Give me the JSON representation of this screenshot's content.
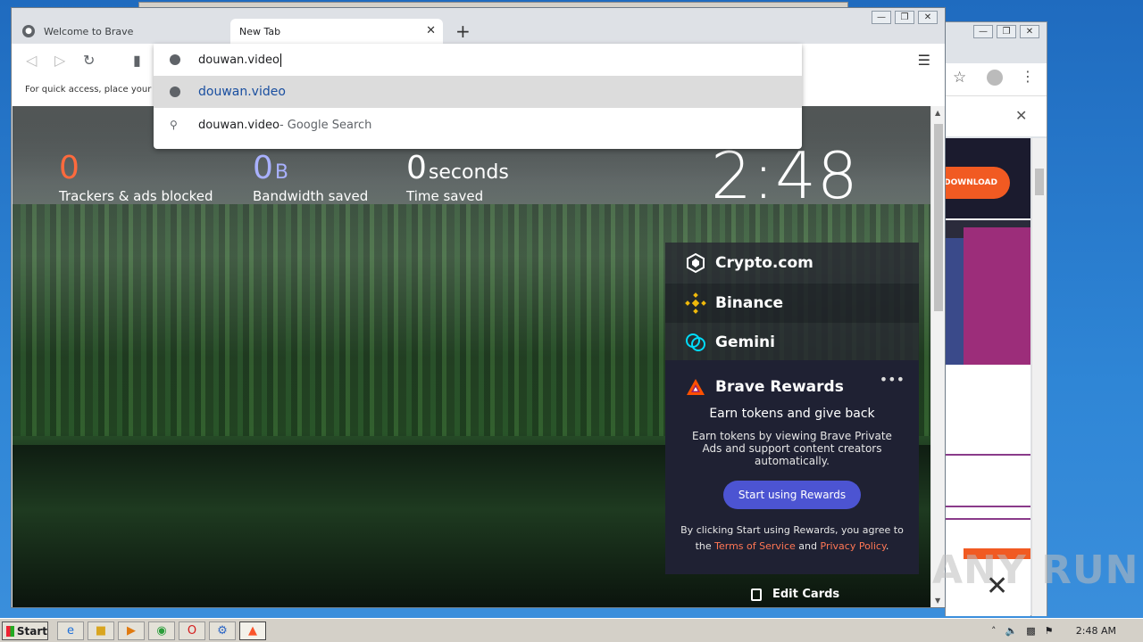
{
  "browser": {
    "tabs": [
      {
        "label": "Welcome to Brave",
        "active": false
      },
      {
        "label": "New Tab",
        "active": true
      }
    ],
    "new_tab_glyph": "+",
    "bookmark_hint": "For quick access, place your b",
    "omnibox": {
      "value": "douwan.video",
      "suggestions": [
        {
          "main": "douwan.video",
          "sub": "",
          "icon": "globe-icon"
        },
        {
          "main": "douwan.video",
          "sub": " - Google Search",
          "icon": "search-icon"
        }
      ]
    }
  },
  "new_tab": {
    "stats": [
      {
        "value": "0",
        "unit": "",
        "label": "Trackers & ads blocked",
        "color": "#ff6a3d"
      },
      {
        "value": "0",
        "unit": "B",
        "label": "Bandwidth saved",
        "color": "#a9b1ff"
      },
      {
        "value": "0",
        "unit": "seconds",
        "label": "Time saved",
        "color": "#ffffff"
      }
    ],
    "clock": "2:48",
    "widgets": {
      "crypto": "Crypto.com",
      "binance": "Binance",
      "gemini": "Gemini"
    },
    "rewards": {
      "title": "Brave Rewards",
      "more": "•••",
      "heading": "Earn tokens and give back",
      "body": "Earn tokens by viewing Brave Private Ads and support content creators automatically.",
      "button": "Start using Rewards",
      "terms_prefix": "By clicking Start using Rewards, you agree to the",
      "terms_link": "Terms of Service",
      "terms_and": "and",
      "privacy_link": "Privacy Policy",
      "terms_suffix": "."
    },
    "edit_cards": "Edit Cards"
  },
  "background_window": {
    "download_label": "DOWNLOAD"
  },
  "watermark": "ANY RUN",
  "taskbar": {
    "start": "Start",
    "time": "2:48 AM"
  },
  "colors": {
    "accent_orange": "#ff7654",
    "rewards_button": "#4c54d2"
  }
}
